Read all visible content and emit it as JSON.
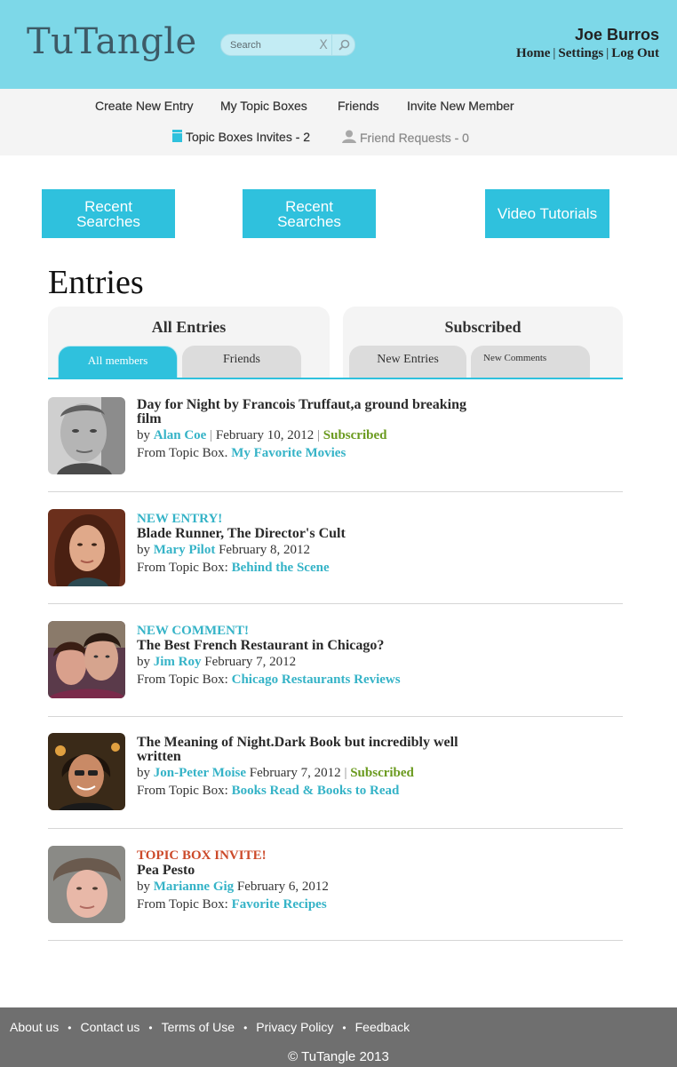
{
  "header": {
    "logo": "TuTangle",
    "search": {
      "placeholder": "Search",
      "clear_glyph": "X",
      "icon": "search-icon"
    },
    "username": "Joe Burros",
    "links": [
      "Home",
      "Settings",
      "Log Out"
    ],
    "bg_color": "#7dd8e8"
  },
  "nav": {
    "items": [
      "Create New Entry",
      "My Topic Boxes",
      "Friends",
      "Invite New Member"
    ],
    "invites": "Topic Boxes Invites - 2",
    "friend_requests": "Friend Requests - 0"
  },
  "quick_buttons": [
    "Recent Searches",
    "Recent Searches",
    "Video Tutorials"
  ],
  "accent_color": "#2fc1dd",
  "entries_title": "Entries",
  "tabs": {
    "all_entries": {
      "title": "All Entries",
      "tabs": [
        "All members",
        "Friends"
      ],
      "active": "All members"
    },
    "subscribed": {
      "title": "Subscribed",
      "tabs": [
        "New Entries",
        "New Comments"
      ]
    }
  },
  "entries": [
    {
      "flag": "",
      "title": "Day for Night by Francois Truffaut,a ground breaking film",
      "by": "by",
      "author": "Alan Coe",
      "date": "February 10, 2012",
      "subscribed": "Subscribed",
      "from_label": "From Topic Box.",
      "topic_box": "My Favorite Movies"
    },
    {
      "flag": "NEW ENTRY!",
      "title": "Blade Runner, The Director's Cult",
      "by": "by",
      "author": "Mary Pilot",
      "date": "February 8, 2012",
      "subscribed": "",
      "from_label": "From Topic Box:",
      "topic_box": "Behind the Scene"
    },
    {
      "flag": "NEW COMMENT!",
      "title": "The Best French Restaurant in Chicago?",
      "by": "by",
      "author": "Jim Roy",
      "date": "February 7, 2012",
      "subscribed": "",
      "from_label": "From Topic Box:",
      "topic_box": "Chicago Restaurants Reviews"
    },
    {
      "flag": "",
      "title": "The Meaning of Night.Dark Book but incredibly well written",
      "by": "by",
      "author": "Jon-Peter Moise",
      "date": "February 7, 2012",
      "subscribed": "Subscribed",
      "from_label": "From Topic Box:",
      "topic_box": "Books Read & Books to Read"
    },
    {
      "flag": "TOPIC BOX INVITE!",
      "title": "Pea Pesto",
      "by": "by",
      "author": "Marianne Gig",
      "date": "February 6, 2012",
      "subscribed": "",
      "from_label": "From Topic Box:",
      "topic_box": "Favorite Recipes"
    }
  ],
  "footer": {
    "links": [
      "About us",
      "Contact us",
      "Terms of Use",
      "Privacy Policy",
      "Feedback"
    ],
    "copyright": "© TuTangle 2013"
  }
}
